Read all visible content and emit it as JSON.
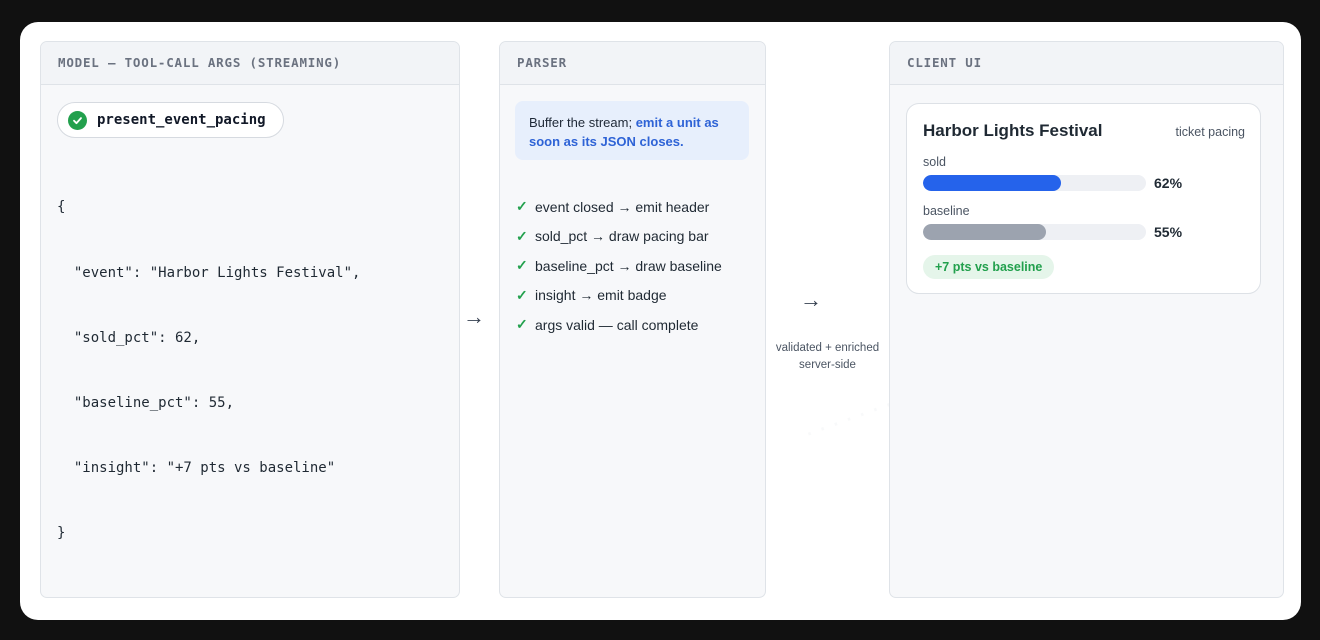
{
  "panels": {
    "model": {
      "title": "MODEL — TOOL-CALL ARGS (STREAMING)",
      "tool_name": "present_event_pacing",
      "code_lines": [
        "{",
        "  \"event\": \"Harbor Lights Festival\",",
        "  \"sold_pct\": 62,",
        "  \"baseline_pct\": 55,",
        "  \"insight\": \"+7 pts vs baseline\"",
        "}"
      ]
    },
    "parser": {
      "title": "PARSER",
      "note_plain": "Buffer the stream; ",
      "note_highlight": "emit a unit as soon as its JSON closes.",
      "steps": [
        "event closed → emit header",
        "sold_pct → draw pacing bar",
        "baseline_pct → draw baseline",
        "insight → emit badge",
        "args valid — call complete"
      ]
    },
    "client": {
      "title": "CLIENT UI",
      "card": {
        "title": "Harbor Lights Festival",
        "subtitle": "ticket pacing",
        "sold_label": "sold",
        "sold_pct": 62,
        "sold_text": "62%",
        "baseline_label": "baseline",
        "baseline_pct": 55,
        "baseline_text": "55%",
        "badge": "+7 pts vs baseline"
      }
    }
  },
  "connectors": {
    "arrow_glyph": "→",
    "server_label_line1": "validated + enriched",
    "server_label_line2": "server-side"
  },
  "colors": {
    "sold_bar": "#2563eb",
    "baseline_bar": "#9ca3af",
    "check_green": "#22a04d",
    "badge_bg": "#e5f5ea",
    "note_bg": "#e7effc",
    "highlight_blue": "#2e63d6"
  },
  "icons": {
    "tool_status": "check-circle-icon",
    "step_status": "checkmark-icon"
  }
}
